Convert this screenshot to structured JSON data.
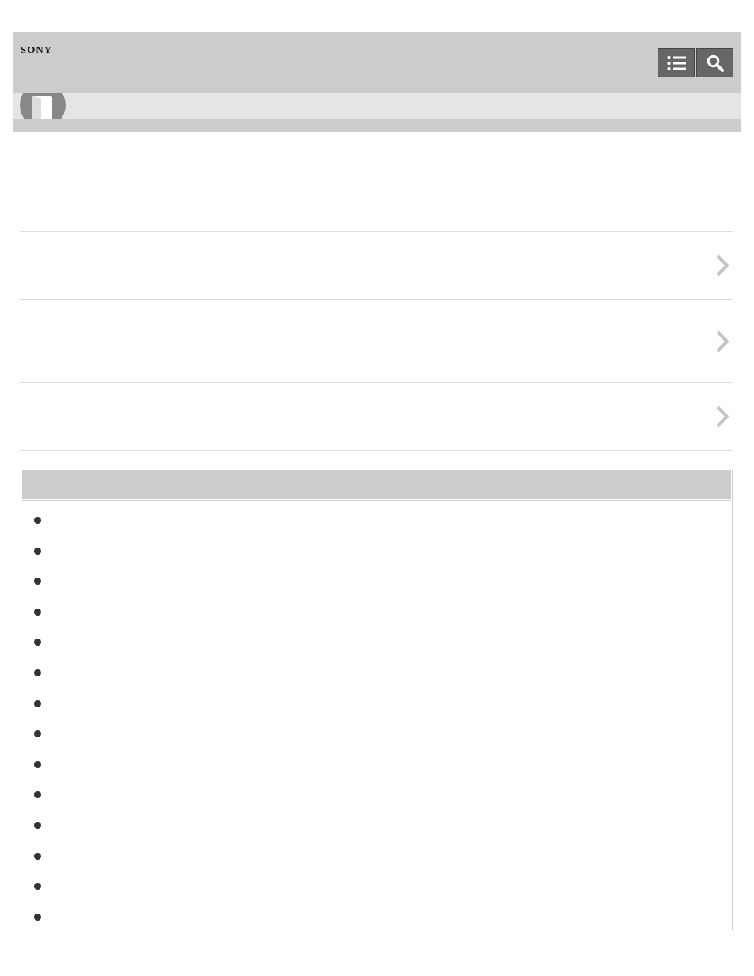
{
  "header": {
    "logo": "SONY"
  },
  "links": [
    {
      "kind": "link"
    },
    {
      "kind": "tall-link"
    },
    {
      "kind": "link"
    }
  ],
  "box": {
    "bullets": [
      {
        "kind": "bullet"
      },
      {
        "kind": "bullet"
      },
      {
        "kind": "bullet"
      },
      {
        "kind": "bullet"
      },
      {
        "kind": "bullet"
      },
      {
        "kind": "bullet"
      },
      {
        "kind": "bullet"
      },
      {
        "kind": "bullet"
      },
      {
        "kind": "bullet"
      },
      {
        "kind": "bullet"
      },
      {
        "kind": "bullet"
      },
      {
        "kind": "bullet"
      },
      {
        "kind": "bullet"
      },
      {
        "kind": "bullet"
      }
    ]
  }
}
